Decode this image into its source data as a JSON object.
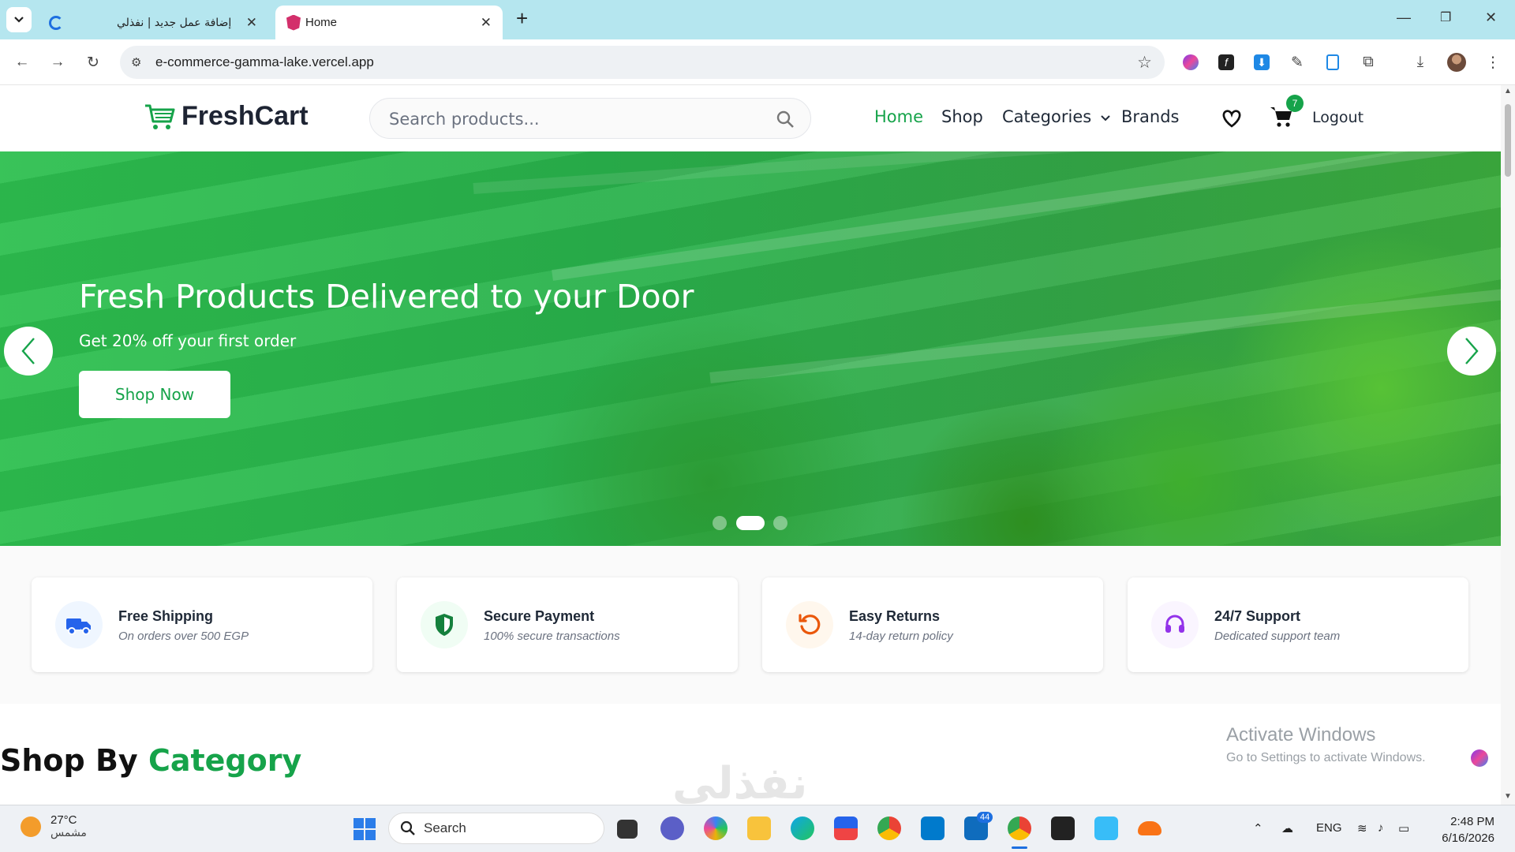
{
  "browser": {
    "tabs": [
      {
        "title": "إضافة عمل جديد | نفذلي",
        "active": false
      },
      {
        "title": "Home",
        "active": true
      }
    ],
    "new_tab_symbol": "+",
    "url": "e-commerce-gamma-lake.vercel.app",
    "icons": [
      "back-icon",
      "forward-icon",
      "reload-icon",
      "site-info-icon",
      "star-icon",
      "extension-icons",
      "download-icon",
      "profile-avatar",
      "menu-icon"
    ]
  },
  "site": {
    "brand": "FreshCart",
    "search_placeholder": "Search products...",
    "nav": {
      "home": "Home",
      "shop": "Shop",
      "categories": "Categories",
      "brands": "Brands",
      "logout": "Logout"
    },
    "cart_count": "7",
    "accent_color": "#16a34a"
  },
  "hero": {
    "title": "Fresh Products Delivered to your Door",
    "subtitle": "Get 20% off your first order",
    "cta": "Shop Now",
    "slides": 3,
    "active_slide": 2
  },
  "features": [
    {
      "title": "Free Shipping",
      "subtitle": "On orders over 500 EGP",
      "icon": "truck-icon",
      "color": "#2563eb"
    },
    {
      "title": "Secure Payment",
      "subtitle": "100% secure transactions",
      "icon": "shield-icon",
      "color": "#16a34a"
    },
    {
      "title": "Easy Returns",
      "subtitle": "14-day return policy",
      "icon": "return-icon",
      "color": "#ea580c"
    },
    {
      "title": "24/7 Support",
      "subtitle": "Dedicated support team",
      "icon": "headset-icon",
      "color": "#9333ea"
    }
  ],
  "category_heading": {
    "prefix": "Shop By",
    "accent": "Category"
  },
  "windows_notice": {
    "title": "Activate Windows",
    "subtitle": "Go to Settings to activate Windows."
  },
  "watermark": "نفذلي",
  "taskbar": {
    "weather_temp": "27°C",
    "weather_cond": "مشمس",
    "search": "Search",
    "teams_badge": "44",
    "lang": "ENG",
    "time": "2:48 PM",
    "date": "6/16/2026"
  }
}
